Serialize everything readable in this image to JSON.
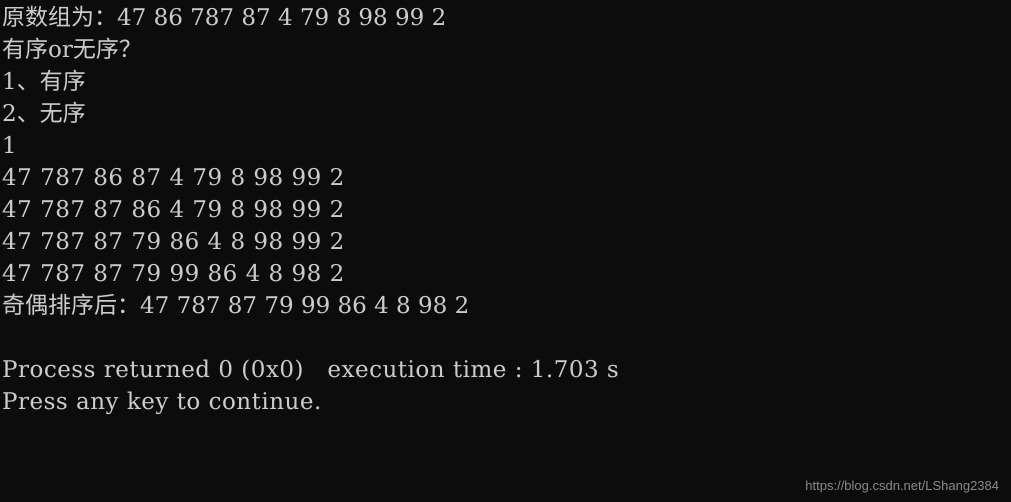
{
  "window": {
    "kind": "console-output",
    "background_color": "#0c0c0c",
    "text_color": "#cccccc"
  },
  "console": {
    "lines": [
      {
        "id": "original-array",
        "text": "原数组为：47 86 787 87 4 79 8 98 99 2",
        "lang": "cn"
      },
      {
        "id": "prompt-question",
        "text": "有序or无序？",
        "lang": "cn"
      },
      {
        "id": "menu-option-1",
        "text": "1、有序",
        "lang": "cn"
      },
      {
        "id": "menu-option-2",
        "text": "2、无序",
        "lang": "cn"
      },
      {
        "id": "user-input",
        "text": "1",
        "lang": "en"
      },
      {
        "id": "pass-1",
        "text": "47 787 86 87 4 79 8 98 99 2",
        "lang": "en"
      },
      {
        "id": "pass-2",
        "text": "47 787 87 86 4 79 8 98 99 2",
        "lang": "en"
      },
      {
        "id": "pass-3",
        "text": "47 787 87 79 86 4 8 98 99 2",
        "lang": "en"
      },
      {
        "id": "pass-4",
        "text": "47 787 87 79 99 86 4 8 98 2",
        "lang": "en"
      },
      {
        "id": "sorted-result",
        "text": "奇偶排序后：47 787 87 79 99 86 4 8 98 2",
        "lang": "cn"
      },
      {
        "id": "spacer",
        "text": " ",
        "lang": "en"
      },
      {
        "id": "process-returned",
        "text": "Process returned 0 (0x0)   execution time : 1.703 s",
        "lang": "en"
      },
      {
        "id": "press-any-key",
        "text": "Press any key to continue.",
        "lang": "en"
      }
    ]
  },
  "watermark": {
    "text": "https://blog.csdn.net/LShang2384",
    "color": "#8a8a8a"
  }
}
